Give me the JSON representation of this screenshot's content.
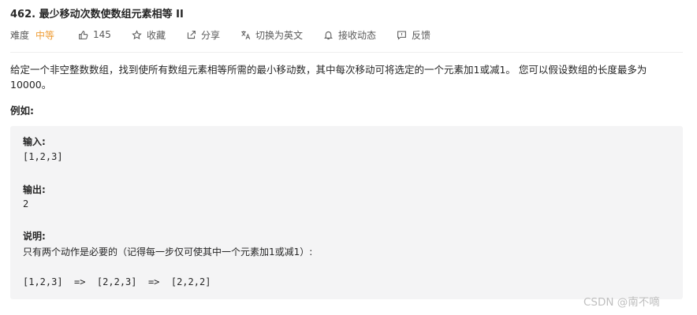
{
  "problem": {
    "title": "462. 最少移动次数使数组元素相等 II"
  },
  "meta": {
    "difficulty_label": "难度",
    "difficulty_value": "中等",
    "likes": "145",
    "favorite_label": "收藏",
    "share_label": "分享",
    "switch_language_label": "切换为英文",
    "subscribe_label": "接收动态",
    "feedback_label": "反馈",
    "difficulty_color": "#ef9d36"
  },
  "description": "给定一个非空整数数组，找到使所有数组元素相等所需的最小移动数，其中每次移动可将选定的一个元素加1或减1。 您可以假设数组的长度最多为10000。",
  "example": {
    "heading": "例如:",
    "input_label": "输入:",
    "input_value": "[1,2,3]",
    "output_label": "输出:",
    "output_value": "2",
    "explanation_label": "说明:",
    "explanation_text": "只有两个动作是必要的（记得每一步仅可使其中一个元素加1或减1）:",
    "steps": "[1,2,3]  =>  [2,2,3]  =>  [2,2,2]"
  },
  "watermark": "CSDN @南不嘀"
}
